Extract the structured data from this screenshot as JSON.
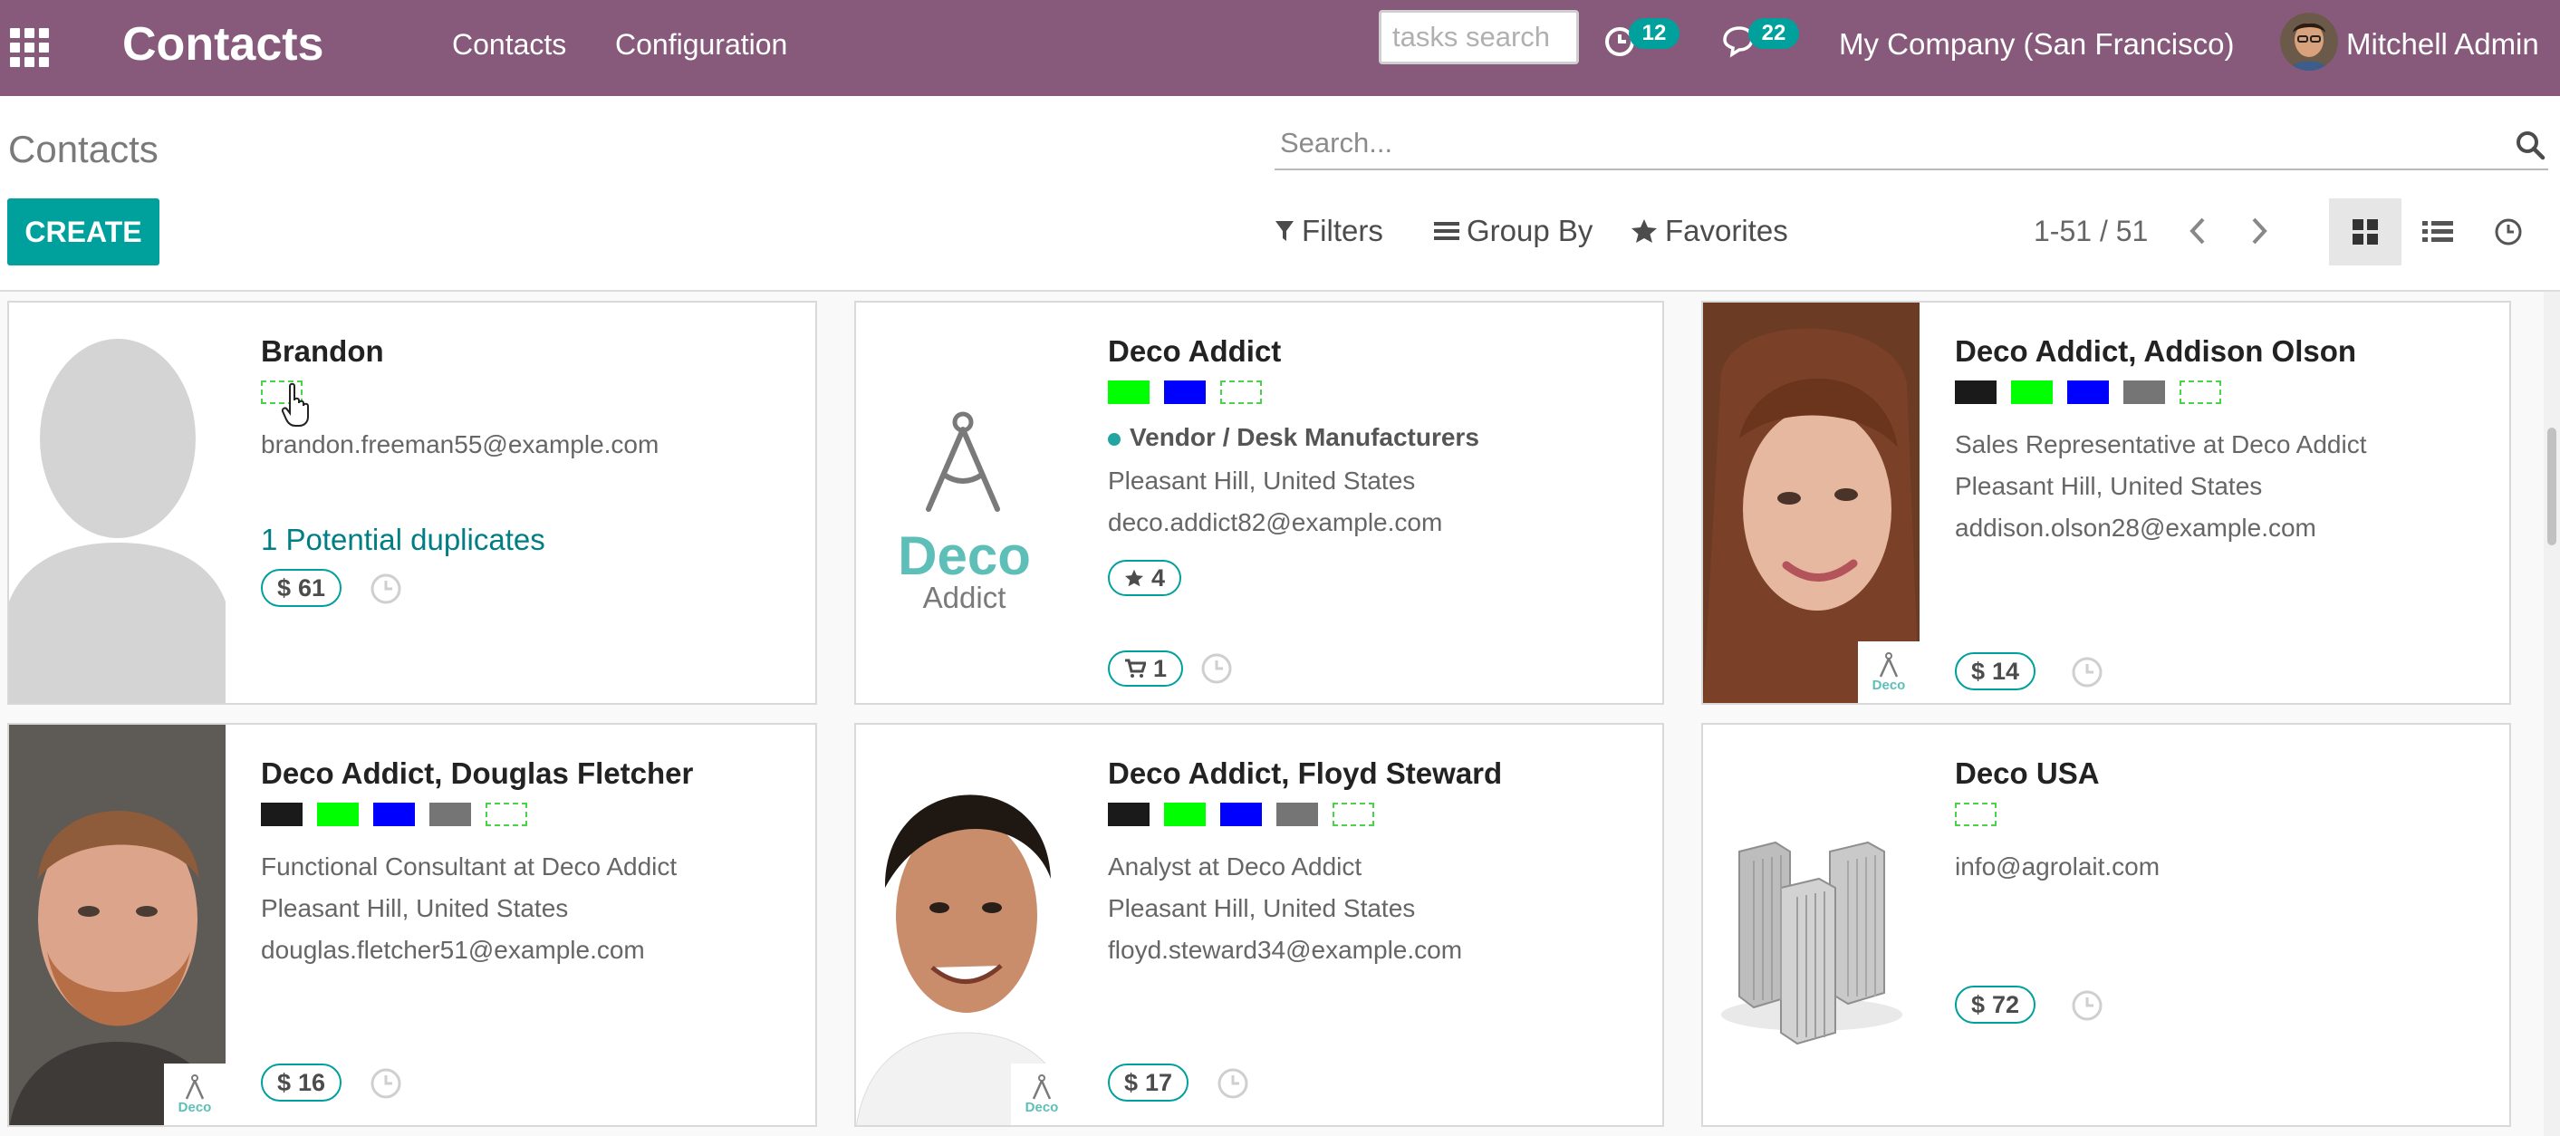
{
  "app": {
    "brand": "Contacts",
    "menu": [
      "Contacts",
      "Configuration"
    ],
    "tasks_search_placeholder": "tasks search",
    "activity_count": "12",
    "messages_count": "22",
    "company": "My Company (San Francisco)",
    "user": "Mitchell Admin"
  },
  "control_panel": {
    "breadcrumb": "Contacts",
    "search_placeholder": "Search...",
    "create_label": "CREATE",
    "filters_label": "Filters",
    "group_by_label": "Group By",
    "favorites_label": "Favorites",
    "pager": "1-51 / 51",
    "view_modes": [
      "kanban",
      "list",
      "activity"
    ],
    "active_view": "kanban"
  },
  "colors": {
    "navbar": "#875a7b",
    "accent": "#00a09d",
    "link": "#017e84"
  },
  "cards": [
    {
      "name": "Brandon",
      "image": "placeholder-person",
      "tags": [
        "empty"
      ],
      "email": "brandon.freeman55@example.com",
      "duplicates": "1 Potential duplicates",
      "amount": "61"
    },
    {
      "name": "Deco Addict",
      "image": "deco-addict-logo",
      "logo_text": {
        "line1": "Deco",
        "line2": "Addict"
      },
      "tags": [
        "green",
        "blue",
        "empty"
      ],
      "category": "Vendor / Desk Manufacturers",
      "location": "Pleasant Hill, United States",
      "email": "deco.addict82@example.com",
      "rating": "4",
      "orders": "1"
    },
    {
      "name": "Deco Addict, Addison Olson",
      "image": "person-photo-woman",
      "tags": [
        "black",
        "green",
        "blue",
        "grey",
        "empty"
      ],
      "job": "Sales Representative at Deco Addict",
      "location": "Pleasant Hill, United States",
      "email": "addison.olson28@example.com",
      "amount": "14",
      "mini_logo": "Deco"
    },
    {
      "name": "Deco Addict, Douglas Fletcher",
      "image": "person-photo-man-beard",
      "tags": [
        "black",
        "green",
        "blue",
        "grey",
        "empty"
      ],
      "job": "Functional Consultant at Deco Addict",
      "location": "Pleasant Hill, United States",
      "email": "douglas.fletcher51@example.com",
      "amount": "16",
      "mini_logo": "Deco"
    },
    {
      "name": "Deco Addict, Floyd Steward",
      "image": "person-photo-man-smiling",
      "tags": [
        "black",
        "green",
        "blue",
        "grey",
        "empty"
      ],
      "job": "Analyst at Deco Addict",
      "location": "Pleasant Hill, United States",
      "email": "floyd.steward34@example.com",
      "amount": "17",
      "mini_logo": "Deco"
    },
    {
      "name": "Deco USA",
      "image": "company-buildings",
      "tags": [
        "empty"
      ],
      "email": "info@agrolait.com",
      "amount": "72"
    }
  ]
}
